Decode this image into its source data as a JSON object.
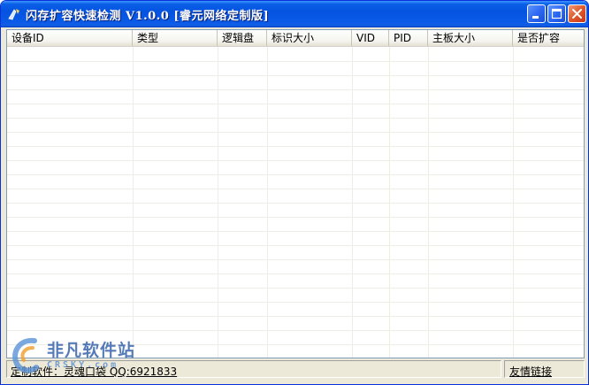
{
  "window": {
    "title": "闪存扩容快速检测 V1.0.0 [睿元网络定制版]",
    "accent_color": "#0a5fe6",
    "buttons": {
      "minimize": "minimize-icon",
      "maximize": "maximize-icon",
      "close": "close-icon"
    }
  },
  "listview": {
    "columns": [
      "设备ID",
      "类型",
      "逻辑盘",
      "标识大小",
      "VID",
      "PID",
      "主板大小",
      "是否扩容"
    ],
    "rows": []
  },
  "statusbar": {
    "left_text": "定制软件：灵魂口袋 QQ:6921833",
    "right_link": "友情链接"
  },
  "watermark": {
    "text": "非凡软件站",
    "sub": "CRSKY.com"
  }
}
